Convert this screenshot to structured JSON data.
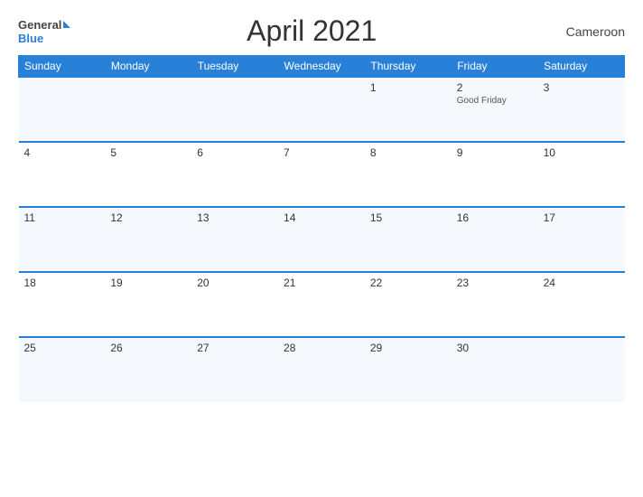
{
  "header": {
    "logo_general": "General",
    "logo_blue": "Blue",
    "title": "April 2021",
    "country": "Cameroon"
  },
  "days_of_week": [
    "Sunday",
    "Monday",
    "Tuesday",
    "Wednesday",
    "Thursday",
    "Friday",
    "Saturday"
  ],
  "weeks": [
    [
      {
        "day": "",
        "event": ""
      },
      {
        "day": "",
        "event": ""
      },
      {
        "day": "",
        "event": ""
      },
      {
        "day": "",
        "event": ""
      },
      {
        "day": "1",
        "event": ""
      },
      {
        "day": "2",
        "event": "Good Friday"
      },
      {
        "day": "3",
        "event": ""
      }
    ],
    [
      {
        "day": "4",
        "event": ""
      },
      {
        "day": "5",
        "event": ""
      },
      {
        "day": "6",
        "event": ""
      },
      {
        "day": "7",
        "event": ""
      },
      {
        "day": "8",
        "event": ""
      },
      {
        "day": "9",
        "event": ""
      },
      {
        "day": "10",
        "event": ""
      }
    ],
    [
      {
        "day": "11",
        "event": ""
      },
      {
        "day": "12",
        "event": ""
      },
      {
        "day": "13",
        "event": ""
      },
      {
        "day": "14",
        "event": ""
      },
      {
        "day": "15",
        "event": ""
      },
      {
        "day": "16",
        "event": ""
      },
      {
        "day": "17",
        "event": ""
      }
    ],
    [
      {
        "day": "18",
        "event": ""
      },
      {
        "day": "19",
        "event": ""
      },
      {
        "day": "20",
        "event": ""
      },
      {
        "day": "21",
        "event": ""
      },
      {
        "day": "22",
        "event": ""
      },
      {
        "day": "23",
        "event": ""
      },
      {
        "day": "24",
        "event": ""
      }
    ],
    [
      {
        "day": "25",
        "event": ""
      },
      {
        "day": "26",
        "event": ""
      },
      {
        "day": "27",
        "event": ""
      },
      {
        "day": "28",
        "event": ""
      },
      {
        "day": "29",
        "event": ""
      },
      {
        "day": "30",
        "event": ""
      },
      {
        "day": "",
        "event": ""
      }
    ]
  ]
}
